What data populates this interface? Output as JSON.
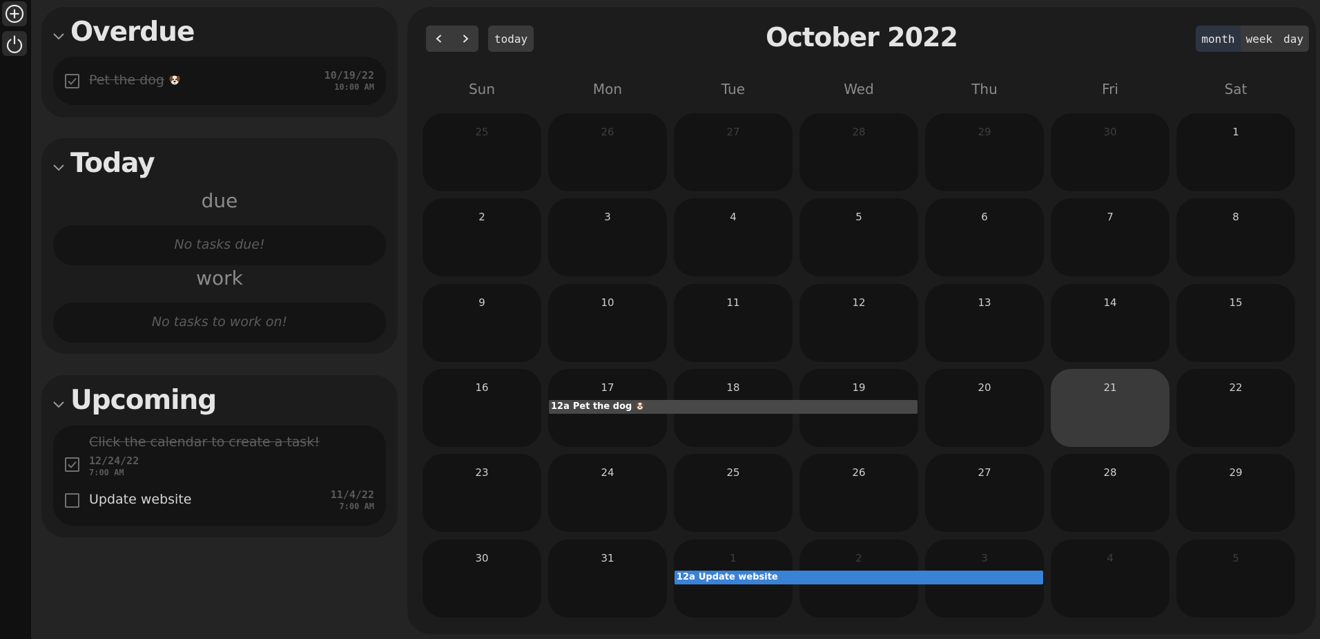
{
  "rail": {
    "add_icon": "plus-circle-icon",
    "power_icon": "power-icon"
  },
  "overdue": {
    "title": "Overdue",
    "tasks": [
      {
        "text": "Pet the dog",
        "emoji_icon": "dog-icon",
        "completed": true,
        "date": "10/19/22",
        "time": "10:00 AM"
      }
    ]
  },
  "today": {
    "title": "Today",
    "due_label": "due",
    "due_empty": "No tasks due!",
    "work_label": "work",
    "work_empty": "No tasks to work on!"
  },
  "upcoming": {
    "title": "Upcoming",
    "tasks": [
      {
        "text": "Click the calendar to create a task!",
        "completed": true,
        "date": "12/24/22",
        "time": "7:00 AM"
      },
      {
        "text": "Update website",
        "completed": false,
        "date": "11/4/22",
        "time": "7:00 AM"
      }
    ]
  },
  "calendar": {
    "title": "October 2022",
    "today_label": "today",
    "views": [
      "month",
      "week",
      "day"
    ],
    "active_view": "month",
    "weekdays": [
      "Sun",
      "Mon",
      "Tue",
      "Wed",
      "Thu",
      "Fri",
      "Sat"
    ],
    "weeks": [
      [
        {
          "d": "25",
          "o": true
        },
        {
          "d": "26",
          "o": true
        },
        {
          "d": "27",
          "o": true
        },
        {
          "d": "28",
          "o": true
        },
        {
          "d": "29",
          "o": true
        },
        {
          "d": "30",
          "o": true
        },
        {
          "d": "1"
        }
      ],
      [
        {
          "d": "2"
        },
        {
          "d": "3"
        },
        {
          "d": "4"
        },
        {
          "d": "5"
        },
        {
          "d": "6"
        },
        {
          "d": "7"
        },
        {
          "d": "8"
        }
      ],
      [
        {
          "d": "9"
        },
        {
          "d": "10"
        },
        {
          "d": "11"
        },
        {
          "d": "12"
        },
        {
          "d": "13"
        },
        {
          "d": "14"
        },
        {
          "d": "15"
        }
      ],
      [
        {
          "d": "16"
        },
        {
          "d": "17"
        },
        {
          "d": "18"
        },
        {
          "d": "19"
        },
        {
          "d": "20"
        },
        {
          "d": "21",
          "today": true
        },
        {
          "d": "22"
        }
      ],
      [
        {
          "d": "23"
        },
        {
          "d": "24"
        },
        {
          "d": "25"
        },
        {
          "d": "26"
        },
        {
          "d": "27"
        },
        {
          "d": "28"
        },
        {
          "d": "29"
        }
      ],
      [
        {
          "d": "30"
        },
        {
          "d": "31"
        },
        {
          "d": "1",
          "o": true
        },
        {
          "d": "2",
          "o": true
        },
        {
          "d": "3",
          "o": true
        },
        {
          "d": "4",
          "o": true
        },
        {
          "d": "5",
          "o": true
        }
      ]
    ],
    "events": [
      {
        "time": "12a",
        "title": "Pet the dog",
        "emoji_icon": "dog-icon",
        "color": "#484848",
        "start": "2022-10-17",
        "end": "2022-10-19"
      },
      {
        "time": "12a",
        "title": "Update website",
        "color": "#3a82d6",
        "start": "2022-11-01",
        "end": "2022-11-03"
      }
    ]
  }
}
